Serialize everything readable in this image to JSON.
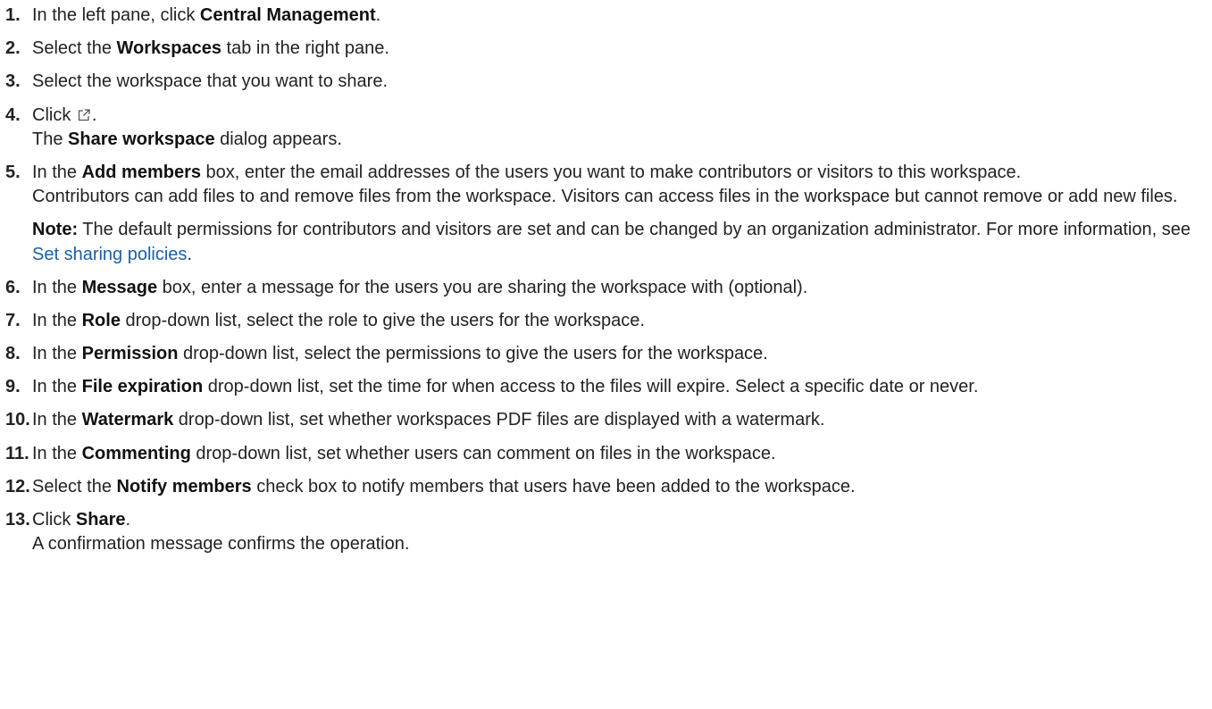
{
  "steps": [
    {
      "num": "1.",
      "t1": "In the left pane, click ",
      "b1": "Central Management",
      "t2": "."
    },
    {
      "num": "2.",
      "t1": "Select the ",
      "b1": "Workspaces",
      "t2": " tab in the right pane."
    },
    {
      "num": "3.",
      "t1": "Select the workspace that you want to share."
    },
    {
      "num": "4.",
      "t1": "Click ",
      "icon": "external-share-icon",
      "t2": ".",
      "r_t1": "The ",
      "r_b1": "Share workspace",
      "r_t2": " dialog appears."
    },
    {
      "num": "5.",
      "t1": "In the ",
      "b1": "Add members",
      "t2": " box, enter the email addresses of the users you want to make contributors or visitors to this workspace.",
      "para": "Contributors can add files to and remove files from the workspace. Visitors can access files in the workspace but cannot remove or add new files.",
      "note_label": "Note:",
      "note_text": " The default permissions for contributors and visitors are set and can be changed by an organization administrator. For more information, see ",
      "note_link": "Set sharing policies",
      "note_end": "."
    },
    {
      "num": "6.",
      "t1": "In the ",
      "b1": "Message",
      "t2": " box, enter a message for the users you are sharing the workspace with (optional)."
    },
    {
      "num": "7.",
      "t1": " In the ",
      "b1": "Role",
      "t2": " drop-down list, select the role to give the users for the workspace."
    },
    {
      "num": "8.",
      "t1": " In the ",
      "b1": "Permission",
      "t2": " drop-down list, select the permissions to give the users for the workspace."
    },
    {
      "num": "9.",
      "t1": " In the ",
      "b1": "File expiration",
      "t2": " drop-down list, set the time for when access to the files will expire. Select a specific date or never."
    },
    {
      "num": "10.",
      "t1": "In the ",
      "b1": "Watermark",
      "t2": " drop-down list, set whether workspaces PDF files are displayed with a watermark."
    },
    {
      "num": "11.",
      "t1": "In the ",
      "b1": "Commenting",
      "t2": " drop-down list, set whether users can comment on files in the workspace."
    },
    {
      "num": "12.",
      "t1": "Select the ",
      "b1": "Notify members",
      "t2": " check box to notify members that users have been added to the workspace."
    },
    {
      "num": "13.",
      "t1": "Click ",
      "b1": "Share",
      "t2": ".",
      "r_t1": "A confirmation message confirms the operation."
    }
  ],
  "colors": {
    "text": "#222222",
    "link": "#1a5fa8"
  }
}
